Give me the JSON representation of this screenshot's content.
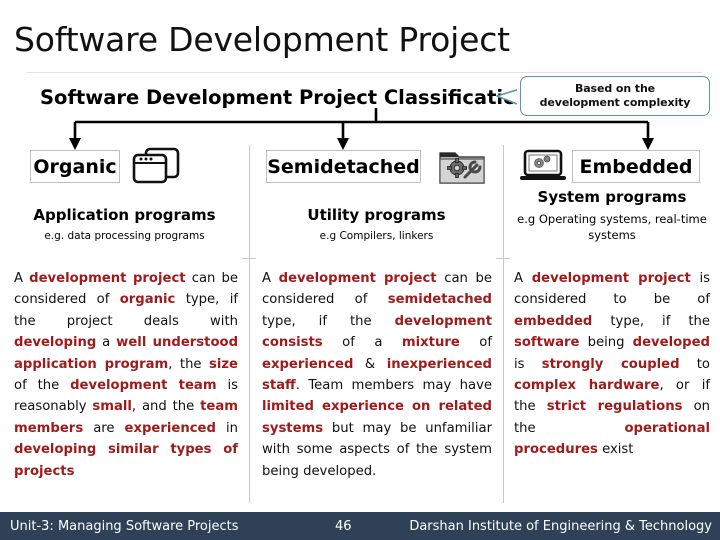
{
  "slide": {
    "title": "Software Development Project",
    "classification_header": "Software Development Project Classification",
    "callout": {
      "line1": "Based on the",
      "line2": "development complexity"
    }
  },
  "categories": [
    {
      "label": "Organic",
      "icon": "windows-application-icon",
      "subtitle": "Application programs",
      "example": "e.g. data processing programs",
      "body": [
        {
          "t": "A ",
          "h": false
        },
        {
          "t": "development project",
          "h": true
        },
        {
          "t": " can be considered of ",
          "h": false
        },
        {
          "t": "organic",
          "h": true
        },
        {
          "t": " type, if the project deals with ",
          "h": false
        },
        {
          "t": "developing",
          "h": true
        },
        {
          "t": " a ",
          "h": false
        },
        {
          "t": "well understood application program",
          "h": true
        },
        {
          "t": ", the ",
          "h": false
        },
        {
          "t": "size",
          "h": true
        },
        {
          "t": " of the ",
          "h": false
        },
        {
          "t": "development team",
          "h": true
        },
        {
          "t": " is reasonably ",
          "h": false
        },
        {
          "t": "small",
          "h": true
        },
        {
          "t": ", and the ",
          "h": false
        },
        {
          "t": "team members",
          "h": true
        },
        {
          "t": " are ",
          "h": false
        },
        {
          "t": "experienced",
          "h": true
        },
        {
          "t": " in ",
          "h": false
        },
        {
          "t": "developing similar types of projects",
          "h": true
        }
      ]
    },
    {
      "label": "Semidetached",
      "icon": "folder-utilities-icon",
      "subtitle": "Utility programs",
      "example": "e.g Compilers, linkers",
      "body": [
        {
          "t": "A ",
          "h": false
        },
        {
          "t": "development project",
          "h": true
        },
        {
          "t": " can be considered of ",
          "h": false
        },
        {
          "t": "semidetached",
          "h": true
        },
        {
          "t": " type, if the ",
          "h": false
        },
        {
          "t": "development consists",
          "h": true
        },
        {
          "t": " of a ",
          "h": false
        },
        {
          "t": "mixture",
          "h": true
        },
        {
          "t": " of ",
          "h": false
        },
        {
          "t": "experienced",
          "h": true
        },
        {
          "t": " & ",
          "h": false
        },
        {
          "t": "inexperienced staff",
          "h": true
        },
        {
          "t": ". Team members may have ",
          "h": false
        },
        {
          "t": "limited experience on related systems",
          "h": true
        },
        {
          "t": " but may be unfamiliar with some aspects of the system being developed.",
          "h": false
        }
      ]
    },
    {
      "label": "Embedded",
      "icon": "laptop-gears-icon",
      "subtitle": "System programs",
      "example": "e.g Operating systems, real-time systems",
      "body": [
        {
          "t": "A ",
          "h": false
        },
        {
          "t": "development project",
          "h": true
        },
        {
          "t": " is considered to be of ",
          "h": false
        },
        {
          "t": "embedded",
          "h": true
        },
        {
          "t": " type, if the ",
          "h": false
        },
        {
          "t": "software",
          "h": true
        },
        {
          "t": " being ",
          "h": false
        },
        {
          "t": "developed",
          "h": true
        },
        {
          "t": " is ",
          "h": false
        },
        {
          "t": "strongly coupled",
          "h": true
        },
        {
          "t": " to ",
          "h": false
        },
        {
          "t": "complex hardware",
          "h": true
        },
        {
          "t": ", or if the ",
          "h": false
        },
        {
          "t": "strict regulations",
          "h": true
        },
        {
          "t": " on the ",
          "h": false
        },
        {
          "t": "operational procedures",
          "h": true
        },
        {
          "t": " exist",
          "h": false
        }
      ]
    }
  ],
  "footer": {
    "left": "Unit-3: Managing Software Projects",
    "page": "46",
    "right": "Darshan Institute of Engineering & Technology"
  },
  "colors": {
    "footer_bg": "#2F4156",
    "highlight_text": "#9E1B1B",
    "callout_border": "#5B97AD",
    "box_border": "#BFBFBF",
    "divider": "#C9C9C9"
  }
}
